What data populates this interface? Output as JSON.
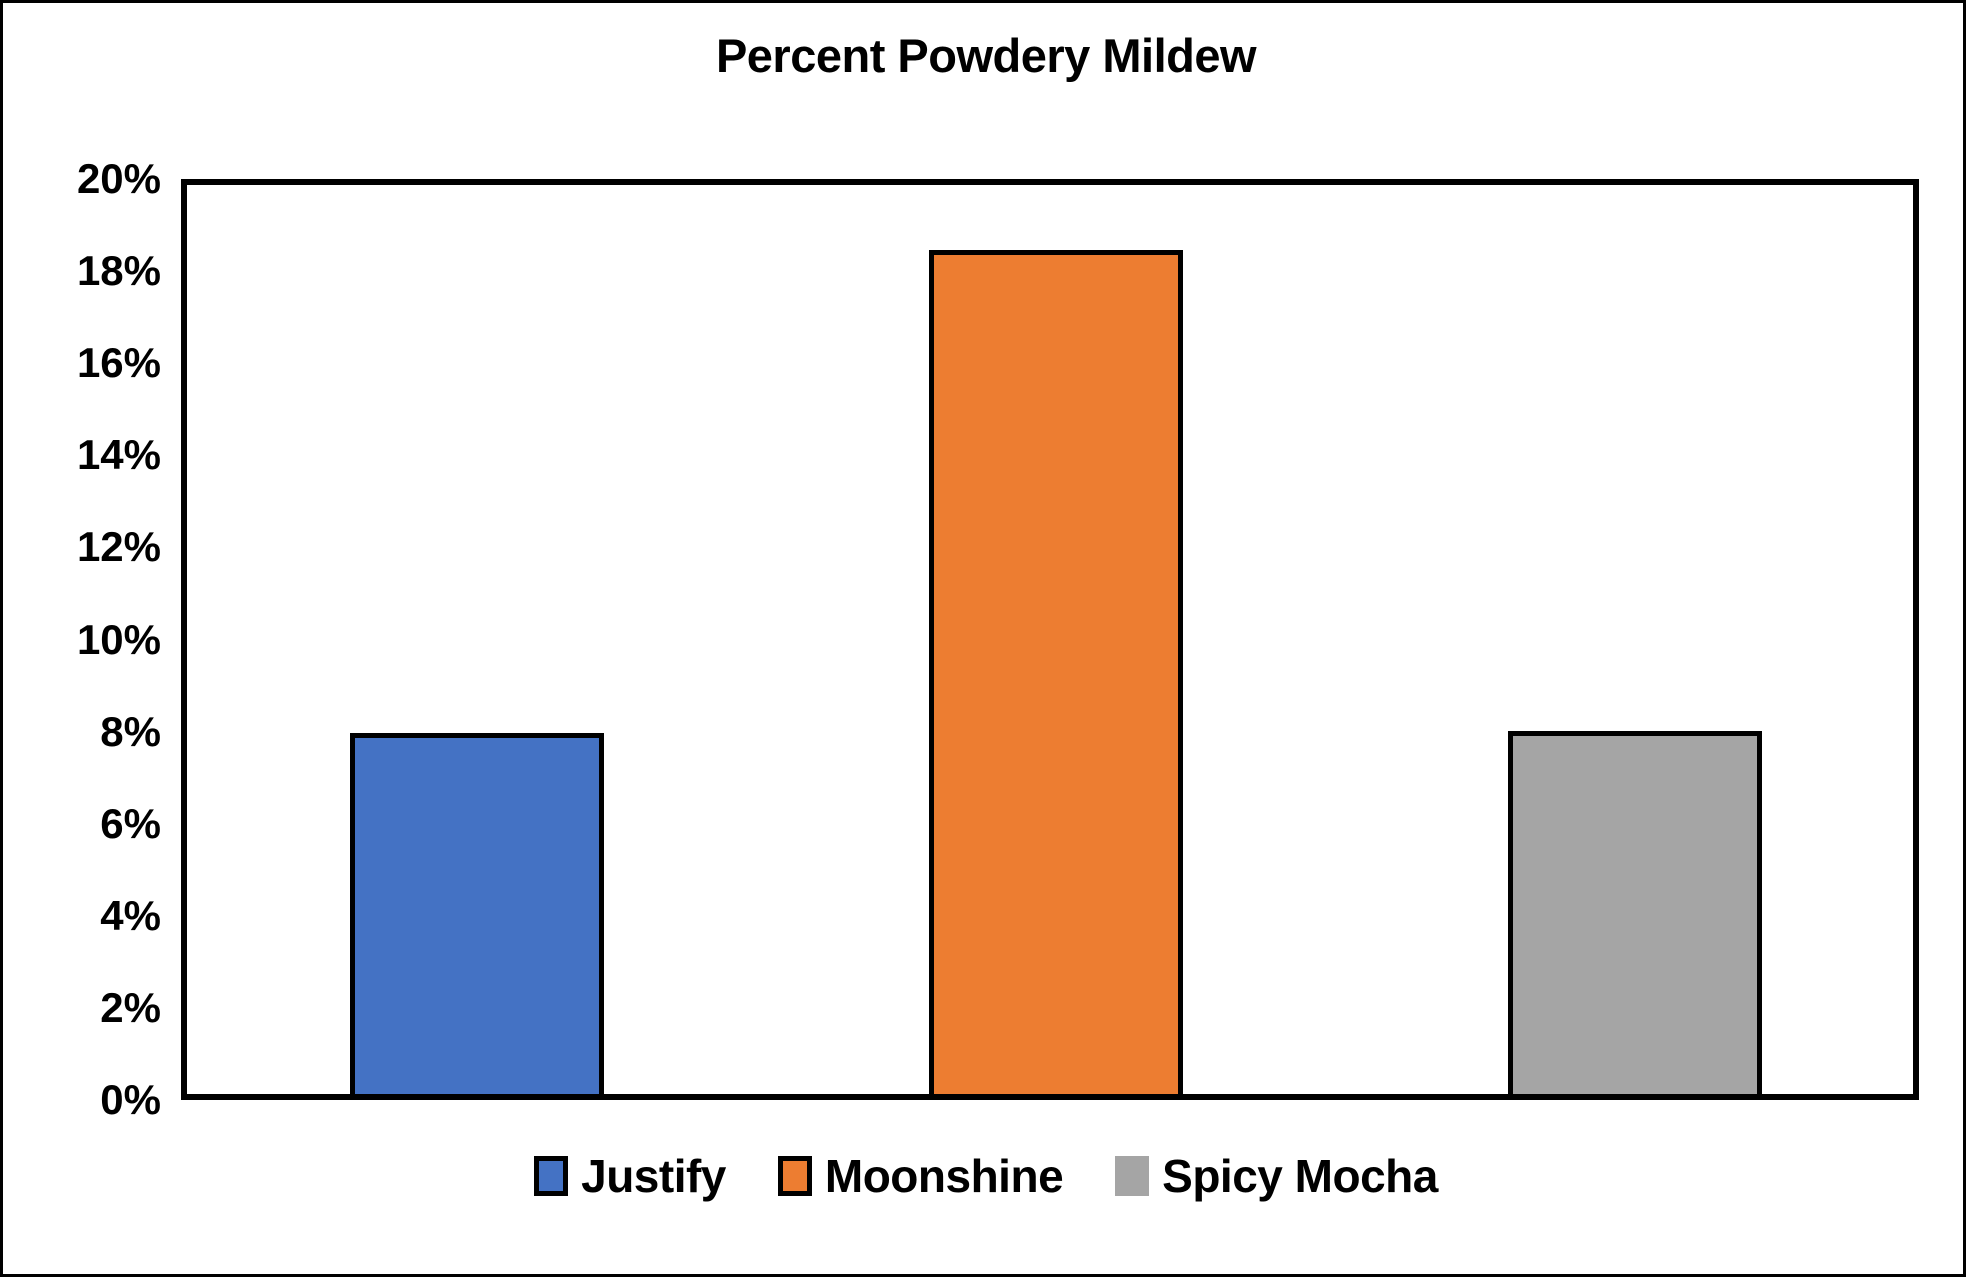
{
  "chart_data": {
    "type": "bar",
    "title": "Percent Powdery Mildew",
    "xlabel": "",
    "ylabel": "",
    "categories": [
      "Justify",
      "Moonshine",
      "Spicy Mocha"
    ],
    "values": [
      7.7,
      18.2,
      7.75
    ],
    "series": [
      {
        "name": "Justify",
        "values": [
          7.7
        ],
        "color": "#4472C4"
      },
      {
        "name": "Moonshine",
        "values": [
          18.2
        ],
        "color": "#ED7D31"
      },
      {
        "name": "Spicy Mocha",
        "values": [
          7.75
        ],
        "color": "#A5A5A5"
      }
    ],
    "ylim": [
      0,
      20
    ],
    "ytick_step": 2,
    "ytick_labels": [
      "0%",
      "2%",
      "4%",
      "6%",
      "8%",
      "10%",
      "12%",
      "14%",
      "16%",
      "18%",
      "20%"
    ],
    "ytick_values": [
      0,
      2,
      4,
      6,
      8,
      10,
      12,
      14,
      16,
      18,
      20
    ],
    "xtick_labels": [],
    "grid": false,
    "legend": {
      "position": "bottom",
      "entries": [
        {
          "label": "Justify",
          "color": "#4472C4",
          "bordered": true
        },
        {
          "label": "Moonshine",
          "color": "#ED7D31",
          "bordered": true
        },
        {
          "label": "Spicy Mocha",
          "color": "#A5A5A5",
          "bordered": false
        }
      ]
    },
    "style": {
      "bar_outline": "#000000",
      "plot_border": "#000000",
      "figure_border": "#000000",
      "background": "#FFFFFF",
      "text_color": "#000000"
    }
  }
}
